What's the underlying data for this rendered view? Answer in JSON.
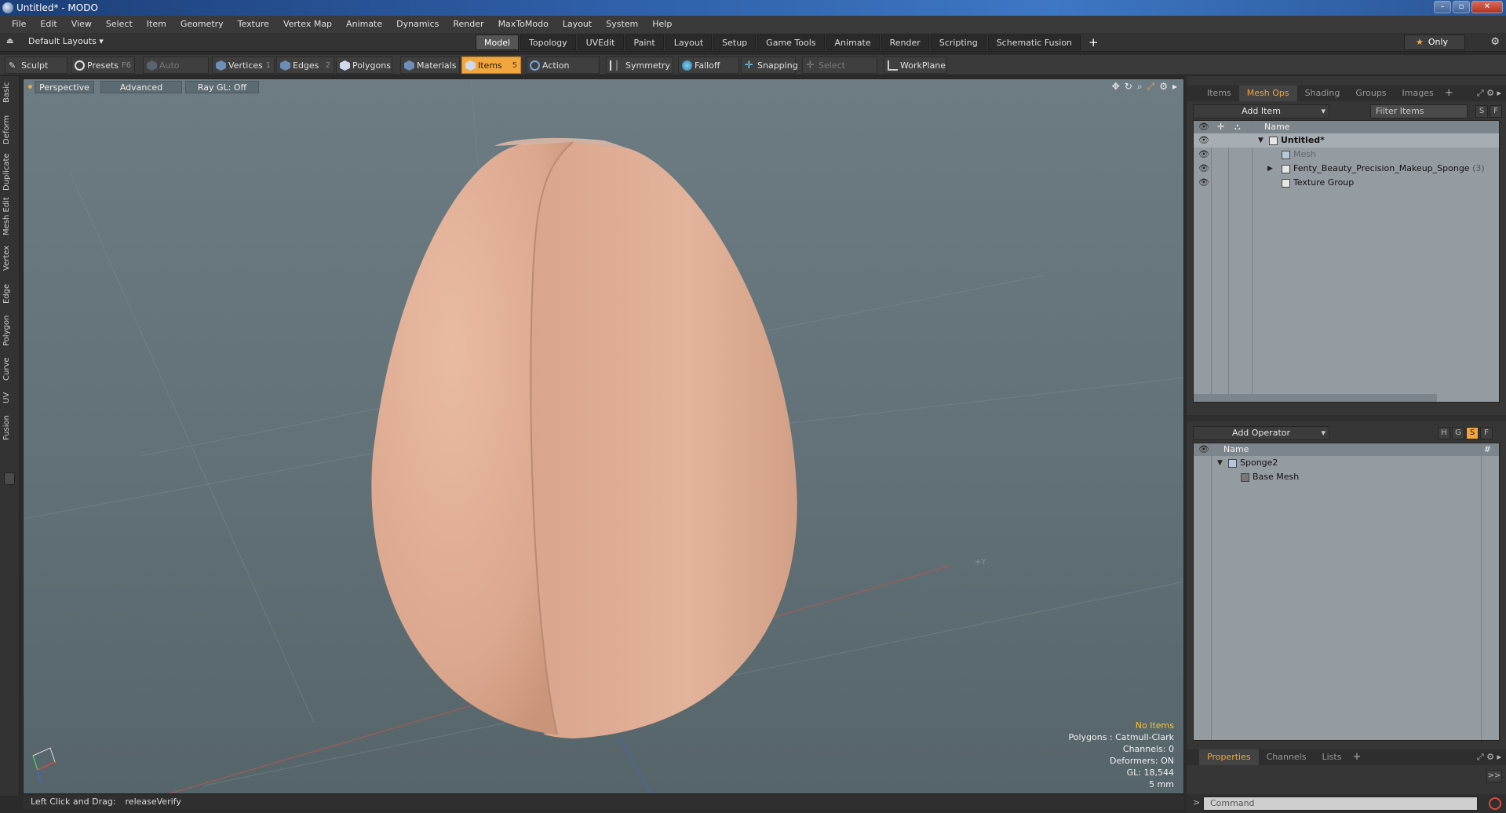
{
  "window": {
    "title": "Untitled* - MODO",
    "buttons": [
      "–",
      "▫",
      "✕"
    ]
  },
  "menu": [
    "File",
    "Edit",
    "View",
    "Select",
    "Item",
    "Geometry",
    "Texture",
    "Vertex Map",
    "Animate",
    "Dynamics",
    "Render",
    "MaxToModo",
    "Layout",
    "System",
    "Help"
  ],
  "layoutbar": {
    "layout_select": "Default Layouts ▾",
    "tabs": [
      "Model",
      "Topology",
      "UVEdit",
      "Paint",
      "Layout",
      "Setup",
      "Game Tools",
      "Animate",
      "Render",
      "Scripting",
      "Schematic Fusion"
    ],
    "active_tab": "Model",
    "add_tab": "+",
    "only_label": "Only"
  },
  "toolbar": {
    "sculpt": "Sculpt",
    "presets": "Presets",
    "presets_key": "F6",
    "auto_select": "Auto Select",
    "vertices": "Vertices",
    "vertices_key": "1",
    "edges": "Edges",
    "edges_key": "2",
    "polygons": "Polygons",
    "materials": "Materials",
    "items": "Items",
    "items_key": "5",
    "action_center": "Action Center",
    "symmetry": "Symmetry",
    "falloff": "Falloff",
    "snapping": "Snapping",
    "select_through": "Select Through",
    "workplane": "WorkPlane"
  },
  "left_tabs": [
    "Basic",
    "Deform",
    "Duplicate",
    "Mesh Edit",
    "Vertex",
    "Edge",
    "Polygon",
    "Curve",
    "UV",
    "Fusion"
  ],
  "viewport": {
    "view_mode": "Perspective",
    "shading": "Advanced",
    "raygl": "Ray GL: Off",
    "stats": {
      "no_items": "No Items",
      "polygons": "Polygons : Catmull-Clark",
      "channels": "Channels: 0",
      "deformers": "Deformers: ON",
      "gl": "GL: 18,544",
      "unit": "5 mm"
    },
    "axis_y_label": "+Y"
  },
  "statusbar": {
    "hint_label": "Left Click and Drag:",
    "hint_value": "releaseVerify"
  },
  "items_panel": {
    "tabs": [
      "Items",
      "Mesh Ops",
      "Shading",
      "Groups",
      "Images"
    ],
    "active_tab": "Mesh Ops",
    "add_item": "Add Item",
    "filter_placeholder": "Filter Items",
    "s_btn": "S",
    "f_btn": "F",
    "column_name": "Name",
    "rows": [
      {
        "label": "Untitled*",
        "bold": true
      },
      {
        "label": "Mesh",
        "dim": true
      },
      {
        "label": "Fenty_Beauty_Precision_Makeup_Sponge",
        "count": "(3)"
      },
      {
        "label": "Texture Group"
      }
    ]
  },
  "operator_panel": {
    "add_operator": "Add Operator",
    "h_btn": "H",
    "g_btn": "G",
    "s_btn": "S",
    "f_btn": "F",
    "column_name": "Name",
    "column_hash": "#",
    "rows": [
      {
        "label": "Sponge2"
      },
      {
        "label": "Base Mesh"
      }
    ]
  },
  "properties_panel": {
    "tabs": [
      "Properties",
      "Channels",
      "Lists"
    ],
    "active_tab": "Properties",
    "expand": ">>"
  },
  "command": {
    "placeholder": "Command",
    "prompt": ">"
  },
  "colors": {
    "accent": "#f1a640",
    "sponge_light": "#e6b49c",
    "sponge_dark": "#c89278",
    "viewport_bg": "#657479",
    "stop": "#d84b3a"
  }
}
